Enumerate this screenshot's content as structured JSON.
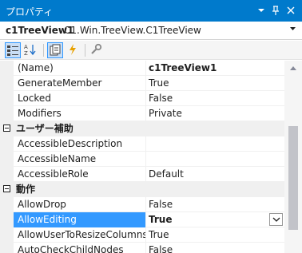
{
  "window": {
    "title": "プロパティ",
    "dropdown_glyph": "▾",
    "pin_glyph": "ᛦ",
    "close_glyph": "✕"
  },
  "selector": {
    "object_name": "c1TreeView1",
    "object_type": "C1.Win.TreeView.C1TreeView",
    "arrow": "▾"
  },
  "toolbar": {
    "buttons": [
      "categorized",
      "alphabetical",
      "properties",
      "events",
      "property-pages"
    ]
  },
  "grid": {
    "rows": [
      {
        "type": "prop",
        "name": "(Name)",
        "value": "c1TreeView1",
        "bold": true
      },
      {
        "type": "prop",
        "name": "GenerateMember",
        "value": "True"
      },
      {
        "type": "prop",
        "name": "Locked",
        "value": "False"
      },
      {
        "type": "prop",
        "name": "Modifiers",
        "value": "Private"
      },
      {
        "type": "cat",
        "name": "ユーザー補助"
      },
      {
        "type": "prop",
        "name": "AccessibleDescription",
        "value": ""
      },
      {
        "type": "prop",
        "name": "AccessibleName",
        "value": ""
      },
      {
        "type": "prop",
        "name": "AccessibleRole",
        "value": "Default"
      },
      {
        "type": "cat",
        "name": "動作"
      },
      {
        "type": "prop",
        "name": "AllowDrop",
        "value": "False"
      },
      {
        "type": "prop",
        "name": "AllowEditing",
        "value": "True",
        "bold": true,
        "selected": true
      },
      {
        "type": "prop",
        "name": "AllowUserToResizeColumns",
        "value": "True"
      },
      {
        "type": "prop",
        "name": "AutoCheckChildNodes",
        "value": "False"
      }
    ]
  }
}
